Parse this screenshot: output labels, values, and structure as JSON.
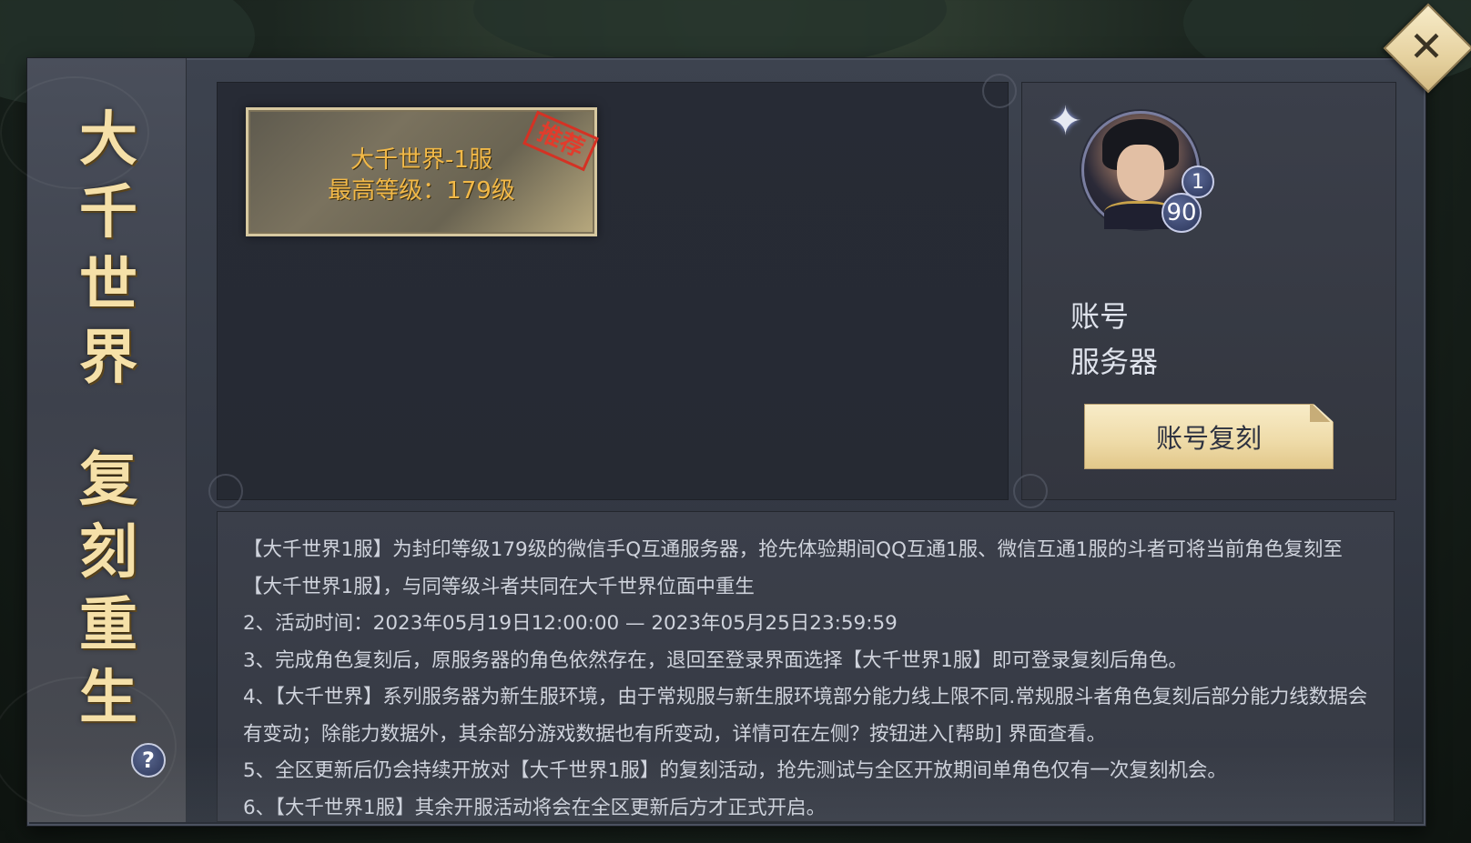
{
  "side_banner": {
    "title_chars": [
      "大",
      "千",
      "世",
      "界",
      "复",
      "刻",
      "重",
      "生"
    ],
    "help_label": "?"
  },
  "server_card": {
    "name": "大千世界-1服",
    "max_level": "最高等级：179级",
    "stamp": "推荐"
  },
  "account_panel": {
    "vip_level": "1",
    "player_level": "90",
    "account_label": "账号",
    "server_label": "服务器",
    "copy_button": "账号复刻"
  },
  "rules": [
    "【大千世界1服】为封印等级179级的微信手Q互通服务器，抢先体验期间QQ互通1服、微信互通1服的斗者可将当前角色复刻至【大千世界1服】，与同等级斗者共同在大千世界位面中重生",
    "2、活动时间：2023年05月19日12:00:00 — 2023年05月25日23:59:59",
    "3、完成角色复刻后，原服务器的角色依然存在，退回至登录界面选择【大千世界1服】即可登录复刻后角色。",
    "4、【大千世界】系列服务器为新生服环境，由于常规服与新生服环境部分能力线上限不同.常规服斗者角色复刻后部分能力线数据会有变动；除能力数据外，其余部分游戏数据也有所变动，详情可在左侧？按钮进入[帮助] 界面查看。",
    "5、全区更新后仍会持续开放对【大千世界1服】的复刻活动，抢先测试与全区开放期间单角色仅有一次复刻机会。",
    "6、【大千世界1服】其余开服活动将会在全区更新后方才正式开启。"
  ],
  "close_label": "✕",
  "colors": {
    "gold_text": "#f2b948",
    "stamp_red": "#e13c2c",
    "button_bg": "#efdcaa",
    "panel_bg": "#3b3f4a"
  }
}
